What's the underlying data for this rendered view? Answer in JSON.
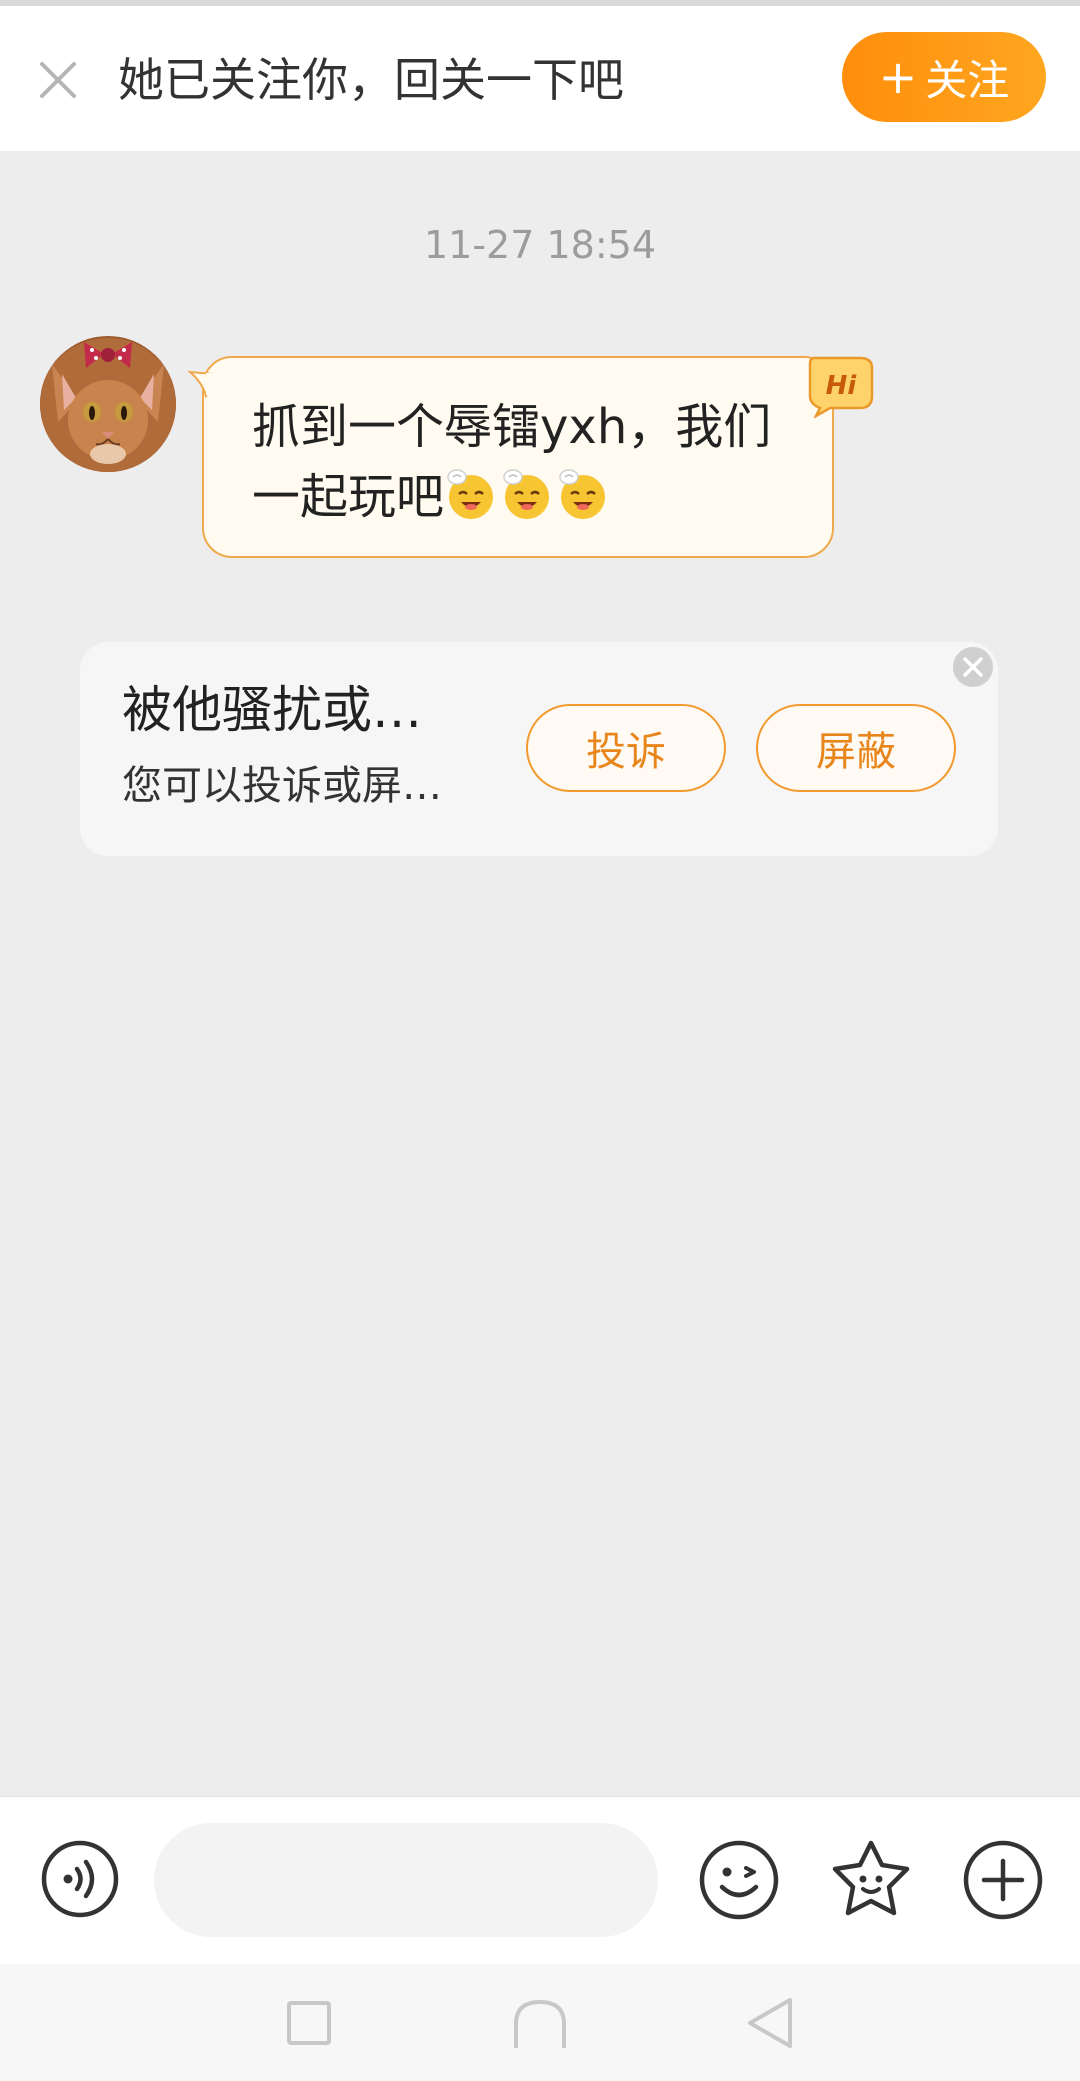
{
  "follow_banner": {
    "text": "她已关注你，回关一下吧",
    "button_label": "关注",
    "button_icon": "plus-icon",
    "accent": "#ff9712"
  },
  "chat": {
    "timestamp": "11-27 18:54",
    "messages": [
      {
        "sender": "other",
        "avatar": "cat-with-bow-avatar",
        "text": "抓到一个辱镭yxh，我们一起玩吧",
        "emojis": [
          "sneezing-face-emoji",
          "sneezing-face-emoji",
          "sneezing-face-emoji"
        ],
        "badge": "Hi",
        "bubble_color": "#fffbf1",
        "bubble_border": "#f0a94a"
      }
    ]
  },
  "harassment_card": {
    "title": "被他骚扰或…",
    "description": "您可以投诉或屏…",
    "complain_label": "投诉",
    "block_label": "屏蔽",
    "close_icon": "close-circle-icon"
  },
  "input_bar": {
    "placeholder": "",
    "icons": [
      "voice-icon",
      "emoji-icon",
      "sticker-icon",
      "plus-icon"
    ]
  },
  "navigation": {
    "icons": [
      "recent-apps-icon",
      "home-icon",
      "back-icon"
    ]
  }
}
